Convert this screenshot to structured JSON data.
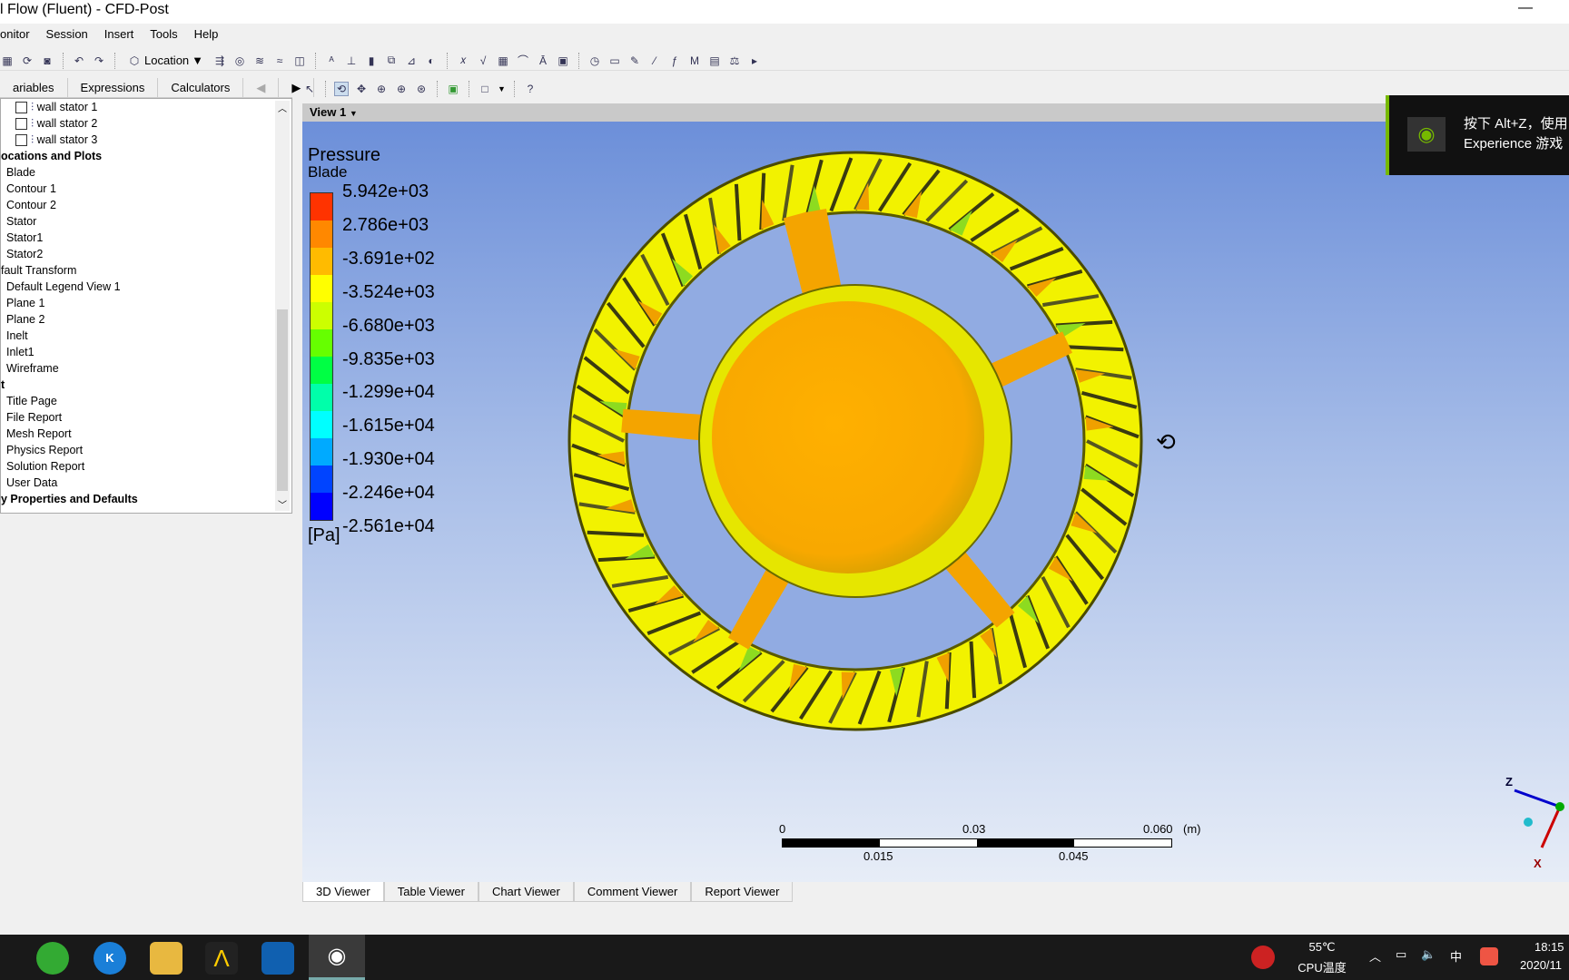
{
  "window": {
    "title": "l Flow (Fluent) - CFD-Post",
    "minimize": "—"
  },
  "menu": [
    "onitor",
    "Session",
    "Insert",
    "Tools",
    "Help"
  ],
  "toolbar": {
    "location_label": "Location"
  },
  "left_tabs": [
    "ariables",
    "Expressions",
    "Calculators"
  ],
  "tree": [
    {
      "label": "wall stator 1",
      "type": "check"
    },
    {
      "label": "wall stator 2",
      "type": "check"
    },
    {
      "label": "wall stator 3",
      "type": "check"
    },
    {
      "label": "ocations and Plots",
      "type": "group"
    },
    {
      "label": "Blade"
    },
    {
      "label": "Contour 1"
    },
    {
      "label": "Contour 2"
    },
    {
      "label": "Stator"
    },
    {
      "label": "Stator1"
    },
    {
      "label": "Stator2"
    },
    {
      "label": "fault Transform",
      "type": "group0"
    },
    {
      "label": "Default Legend View 1"
    },
    {
      "label": "Plane 1"
    },
    {
      "label": "Plane 2"
    },
    {
      "label": "Inelt"
    },
    {
      "label": "Inlet1"
    },
    {
      "label": "Wireframe"
    },
    {
      "label": "t",
      "type": "group"
    },
    {
      "label": "Title Page"
    },
    {
      "label": "File Report"
    },
    {
      "label": "Mesh Report"
    },
    {
      "label": "Physics Report"
    },
    {
      "label": "Solution Report"
    },
    {
      "label": "User Data"
    },
    {
      "label": "y Properties and Defaults",
      "type": "group"
    }
  ],
  "view": {
    "name": "View 1"
  },
  "legend": {
    "title": "Pressure",
    "subtitle": "Blade",
    "unit": "[Pa]",
    "values": [
      "5.942e+03",
      "2.786e+03",
      "-3.691e+02",
      "-3.524e+03",
      "-6.680e+03",
      "-9.835e+03",
      "-1.299e+04",
      "-1.615e+04",
      "-1.930e+04",
      "-2.246e+04",
      "-2.561e+04"
    ],
    "colors": [
      "#ff3300",
      "#ff8800",
      "#ffbb00",
      "#ffff00",
      "#ccff00",
      "#66ff00",
      "#00ff44",
      "#00ffaa",
      "#00ffff",
      "#00aaff",
      "#0044ff",
      "#0000ff"
    ]
  },
  "scale": {
    "top": [
      "0",
      "0.03",
      "0.060",
      "(m)"
    ],
    "bottom": [
      "0.015",
      "0.045"
    ]
  },
  "axes": {
    "z": "Z",
    "x": "X"
  },
  "bottom_tabs": [
    "3D Viewer",
    "Table Viewer",
    "Chart Viewer",
    "Comment Viewer",
    "Report Viewer"
  ],
  "overlay": {
    "line1": "按下 Alt+Z，使用",
    "line2": "Experience 游戏"
  },
  "taskbar": {
    "temp": "55℃",
    "temp_label": "CPU温度",
    "ime": "中",
    "time": "18:15",
    "date": "2020/11"
  }
}
